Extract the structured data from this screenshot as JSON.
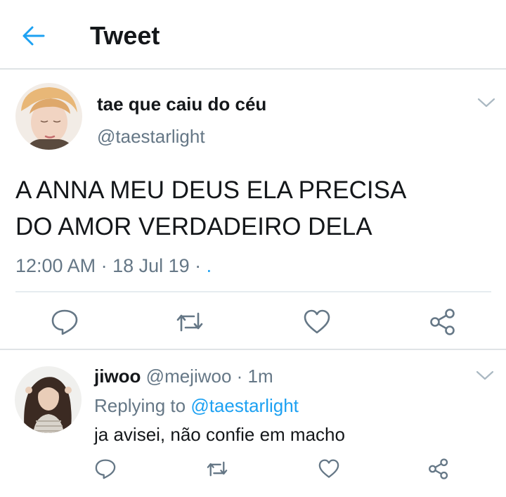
{
  "header": {
    "title": "Tweet"
  },
  "tweet": {
    "display_name": "tae que caiu do céu",
    "handle": "@taestarlight",
    "text_line1": "A ANNA MEU DEUS ELA PRECISA",
    "text_line2": "DO AMOR VERDADEIRO DELA",
    "time": "12:00 AM",
    "separator1": " · ",
    "date": "18 Jul 19",
    "separator2": " · ",
    "source_dot": "."
  },
  "reply": {
    "display_name": "jiwoo",
    "handle": "@mejiwoo",
    "separator": " · ",
    "time": "1m",
    "replying_prefix": "Replying to ",
    "replying_handle": "@taestarlight",
    "text": "ja avisei, não confie em macho"
  },
  "icons": {
    "back": "arrow-left-icon",
    "menu": "chevron-down-icon",
    "reply": "speech-bubble-icon",
    "retweet": "retweet-icon",
    "like": "heart-icon",
    "share": "share-icon"
  },
  "colors": {
    "accent": "#1da1f2",
    "text": "#14171a",
    "secondary_text": "#657786",
    "icon": "#657786",
    "divider": "#dfe3e6"
  }
}
